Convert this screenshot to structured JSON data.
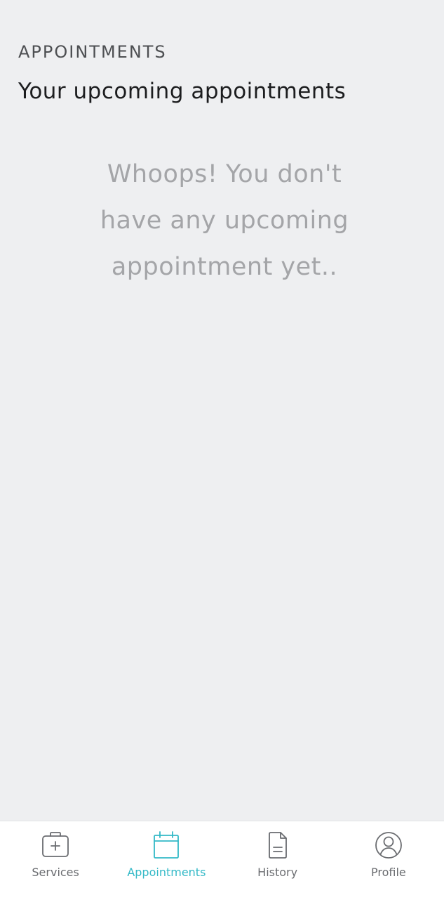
{
  "header": {
    "section_label": "APPOINTMENTS",
    "title": "Your upcoming appointments"
  },
  "empty_state": {
    "lines": [
      "Whoops! You don't",
      "have any upcoming",
      "appointment yet.."
    ]
  },
  "tabs": [
    {
      "label": "Services",
      "icon": "medical-bag-icon",
      "active": false
    },
    {
      "label": "Appointments",
      "icon": "calendar-icon",
      "active": true
    },
    {
      "label": "History",
      "icon": "document-icon",
      "active": false
    },
    {
      "label": "Profile",
      "icon": "user-circle-icon",
      "active": false
    }
  ],
  "colors": {
    "background": "#eeeff1",
    "accent": "#33b9c7",
    "inactive": "#6a6c70"
  }
}
